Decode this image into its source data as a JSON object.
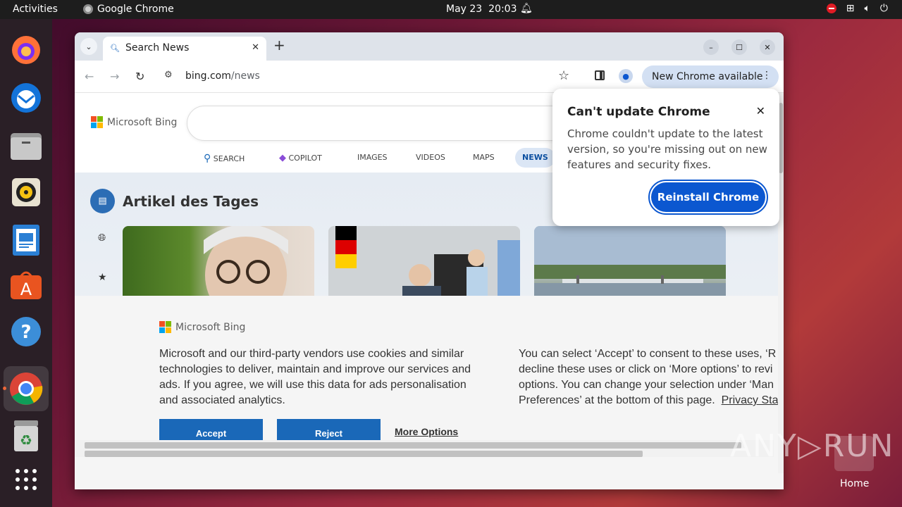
{
  "topbar": {
    "activities": "Activities",
    "app_name": "Google Chrome",
    "date": "May 23",
    "time": "20:03"
  },
  "dock": {
    "items": [
      "firefox-icon",
      "thunderbird-icon",
      "files-icon",
      "rhythmbox-icon",
      "writer-icon",
      "app-center-icon",
      "help-icon",
      "chrome-icon",
      "trash-icon",
      "app-grid-icon"
    ]
  },
  "browser": {
    "tab_title": "Search News",
    "url_domain": "bing.com",
    "url_path": "/news",
    "update_label": "New Chrome available"
  },
  "bing": {
    "brand": "Microsoft Bing",
    "nav": [
      "SEARCH",
      "COPILOT",
      "IMAGES",
      "VIDEOS",
      "MAPS",
      "NEWS"
    ],
    "section_title": "Artikel des Tages"
  },
  "popup": {
    "title": "Can't update Chrome",
    "body": "Chrome couldn't update to the latest version, so you're missing out on new features and security fixes.",
    "button": "Reinstall Chrome"
  },
  "cookie": {
    "brand": "Microsoft Bing",
    "text_left": "Microsoft and our third-party vendors use cookies and similar technologies to deliver, maintain and improve our services and ads. If you agree, we will use this data for ads personalisation and associated analytics.",
    "text_right_1": "You can select ‘Accept’ to consent to these uses, ‘R",
    "text_right_2": "decline these uses or click on ‘More options’ to revi",
    "text_right_3": "options. You can change your selection under ‘Man",
    "text_right_4": "Preferences’ at the bottom of this page.",
    "privacy_link": "Privacy Sta",
    "accept": "Accept",
    "reject": "Reject",
    "more": "More Options"
  },
  "desktop": {
    "watermark": "ANY RUN",
    "home_label": "Home"
  },
  "colors": {
    "accent": "#0b57d0",
    "bing_button": "#1a68b8",
    "ubuntu_orange": "#e95420"
  }
}
